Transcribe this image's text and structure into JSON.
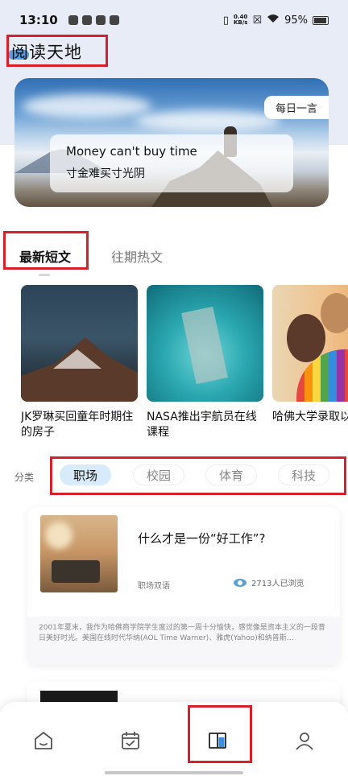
{
  "status_bar": {
    "time": "13:10",
    "net_speed_top": "0.40",
    "net_speed_bottom": "KB/s",
    "battery": "95%"
  },
  "header": {
    "title": "阅读天地"
  },
  "banner": {
    "tag": "每日一言",
    "quote_en": "Money can't buy time",
    "quote_cn": "寸金难买寸光阴"
  },
  "tabs": [
    {
      "label": "最新短文",
      "active": true
    },
    {
      "label": "往期热文",
      "active": false
    }
  ],
  "articles": [
    {
      "title": "JK罗琳买回童年时期住的房子"
    },
    {
      "title": "NASA推出宇航员在线课程"
    },
    {
      "title": "哈佛大学录取以即将完毕"
    }
  ],
  "category": {
    "label": "分类",
    "chips": [
      {
        "label": "职场",
        "active": true
      },
      {
        "label": "校园",
        "active": false
      },
      {
        "label": "体育",
        "active": false
      },
      {
        "label": "科技",
        "active": false
      }
    ]
  },
  "featured": {
    "title": "什么才是一份“好工作”?",
    "tag": "职场双语",
    "views": "2713人已浏览",
    "excerpt": "2001年夏末，我作为哈佛商学院学生度过的第一周十分愉快，感觉像是资本主义的一段昔日美好时光。美国在线时代华纳(AOL Time Warner)、雅虎(Yahoo)和纳普斯…"
  },
  "bottom_nav": [
    {
      "icon": "home-icon",
      "active": false
    },
    {
      "icon": "calendar-check-icon",
      "active": false
    },
    {
      "icon": "book-icon",
      "active": true
    },
    {
      "icon": "profile-icon",
      "active": false
    }
  ],
  "colors": {
    "accent": "#3d8ee0",
    "chip_active_bg": "#d8ebfa",
    "annotation": "#d8202a"
  }
}
